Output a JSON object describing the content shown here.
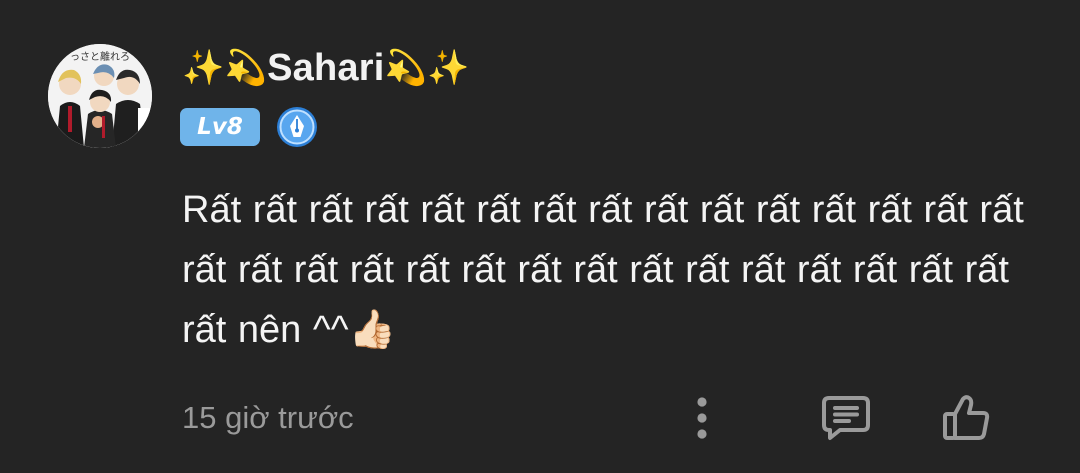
{
  "comment": {
    "author": {
      "name_prefix_emoji": "✨💫",
      "name": "Sahari",
      "name_suffix_emoji": "💫✨",
      "level": "Lv8",
      "avatar_caption": "っさと離れろ"
    },
    "body": "Rất rất rất rất rất rất rất rất rất rất rất rất rất rất rất rất rất rất rất rất rất rất rất rất rất rất rất rất rất rất rất nên ^^👍🏻",
    "timestamp": "15 giờ trước"
  },
  "icons": {
    "more": "vertical-dots-icon",
    "reply": "comment-bubble-icon",
    "like": "thumbs-up-icon",
    "medal": "pen-nib-medal-icon"
  },
  "colors": {
    "background": "#242424",
    "text": "#f4f4f4",
    "muted": "#9a9a9a",
    "level_badge": "#6fb4ea",
    "medal": "#3d8fe0"
  }
}
